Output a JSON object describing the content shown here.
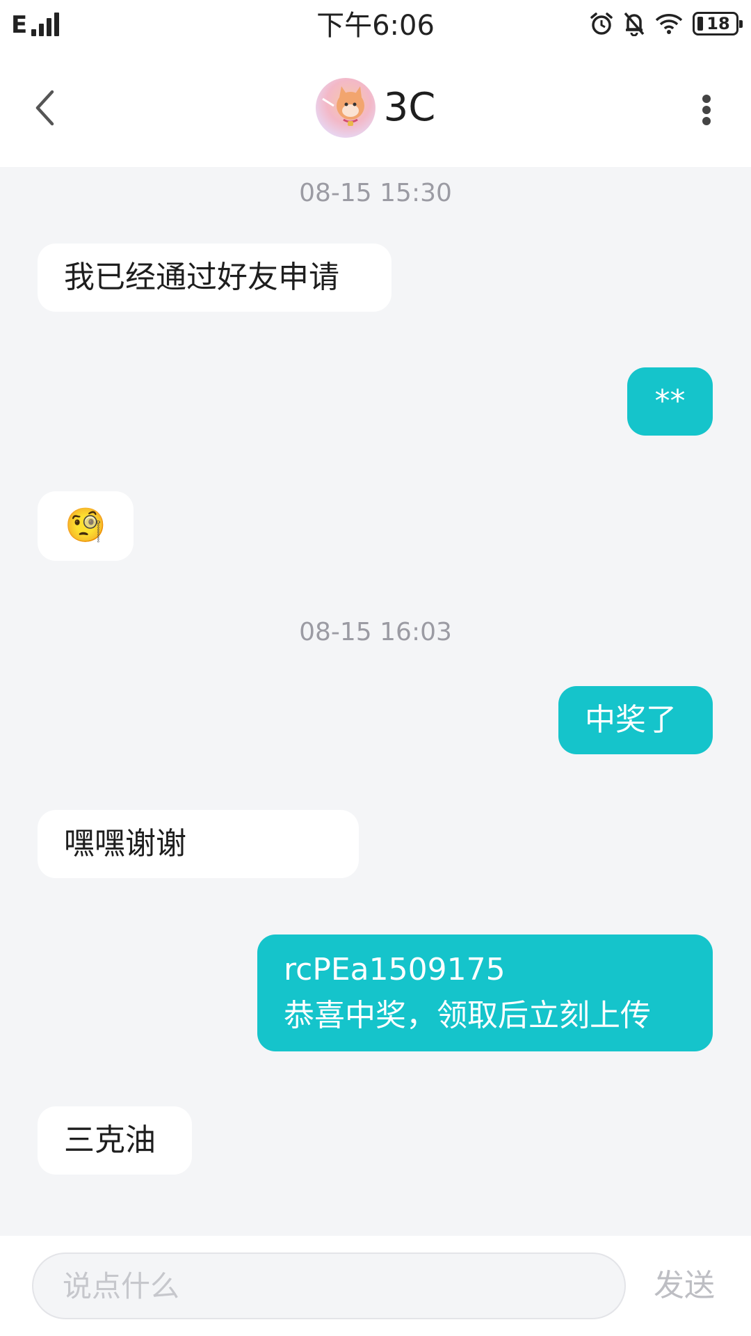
{
  "status_bar": {
    "network": "E",
    "time": "下午6:06",
    "battery": "18",
    "icons": [
      "signal-icon",
      "alarm-icon",
      "bell-off-icon",
      "wifi-icon",
      "battery-icon"
    ]
  },
  "header": {
    "title": "3C",
    "back_icon": "chevron-left-icon",
    "more_icon": "more-vertical-icon"
  },
  "messages": [
    {
      "type": "timestamp",
      "text": "08-15 15:30"
    },
    {
      "type": "incoming",
      "text": "我已经通过好友申请"
    },
    {
      "type": "outgoing",
      "text": "**"
    },
    {
      "type": "incoming",
      "text": "🧐"
    },
    {
      "type": "timestamp",
      "text": "08-15 16:03"
    },
    {
      "type": "outgoing",
      "text": "中奖了"
    },
    {
      "type": "incoming",
      "text": "嘿嘿谢谢"
    },
    {
      "type": "outgoing",
      "lines": [
        "rcPEa1509175",
        "恭喜中奖，领取后立刻上传"
      ]
    },
    {
      "type": "incoming",
      "text": "三克油"
    }
  ],
  "input": {
    "placeholder": "说点什么",
    "value": "",
    "send_label": "发送"
  },
  "colors": {
    "outgoing_bubble": "#15c4cb",
    "incoming_bubble": "#ffffff",
    "background": "#f4f5f7",
    "timestamp": "#9b9ba3"
  }
}
